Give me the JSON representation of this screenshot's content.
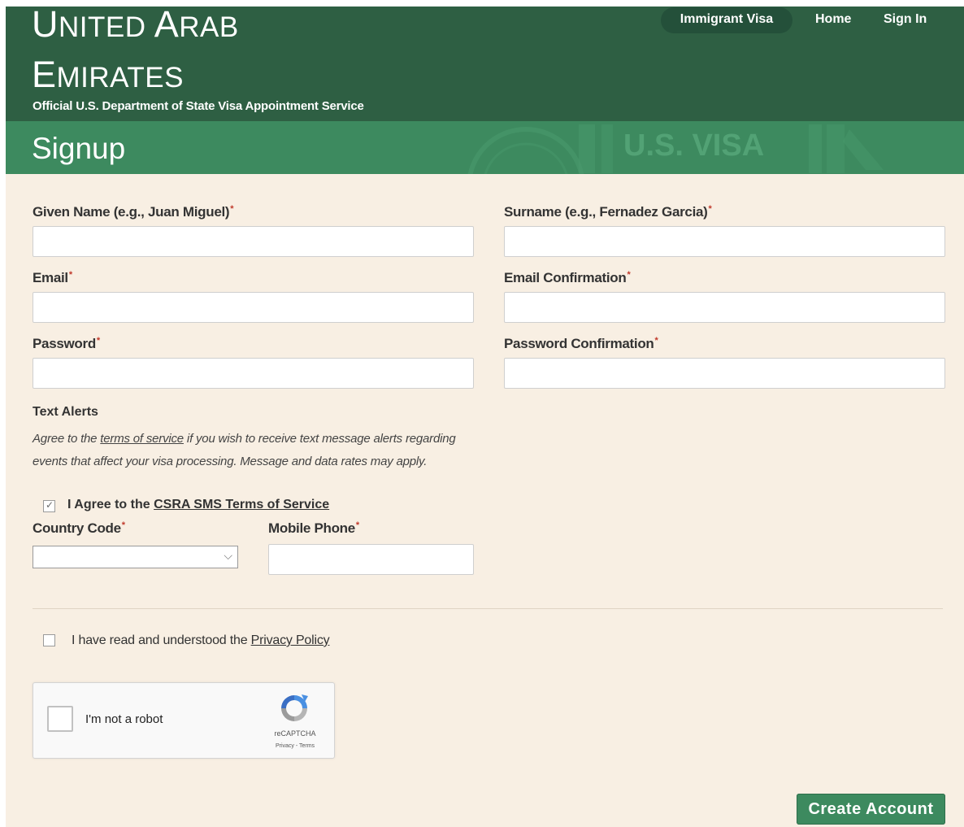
{
  "header": {
    "country_line_1_cap": "U",
    "country_line_1_rest": "nited ",
    "country_line_1_cap2": "A",
    "country_line_1_rest2": "rab",
    "country_line_2_cap": "E",
    "country_line_2_rest": "mirates",
    "subtitle": "Official U.S. Department of State Visa Appointment Service",
    "nav": {
      "immigrant_visa": "Immigrant Visa",
      "home": "Home",
      "sign_in": "Sign In"
    }
  },
  "title_band": {
    "title": "Signup",
    "watermark": "U.S. VISA"
  },
  "form": {
    "given_name": {
      "label": "Given Name (e.g., Juan Miguel)",
      "required_mark": "*",
      "value": ""
    },
    "surname": {
      "label": "Surname (e.g., Fernadez Garcia)",
      "required_mark": "*",
      "value": ""
    },
    "email": {
      "label": "Email",
      "required_mark": "*",
      "value": ""
    },
    "email_confirmation": {
      "label": "Email Confirmation",
      "required_mark": "*",
      "value": ""
    },
    "password": {
      "label": "Password",
      "required_mark": "*",
      "value": ""
    },
    "password_confirmation": {
      "label": "Password Confirmation",
      "required_mark": "*",
      "value": ""
    },
    "text_alerts": {
      "heading": "Text Alerts",
      "desc_before": "Agree to the ",
      "terms_link": "terms of service",
      "desc_after": " if you wish to receive text message alerts regarding events that affect your visa processing. Message and data rates may apply.",
      "sms_check_mark": "✓",
      "sms_label": "I Agree to the ",
      "sms_link": "CSRA SMS Terms of Service"
    },
    "country_code": {
      "label": "Country Code",
      "required_mark": "*",
      "selected": ""
    },
    "mobile_phone": {
      "label": "Mobile Phone",
      "required_mark": "*",
      "value": ""
    },
    "privacy": {
      "label": "I have read and understood the ",
      "link": "Privacy Policy"
    },
    "recaptcha": {
      "label": "I'm not a robot",
      "brand": "reCAPTCHA",
      "links": "Privacy - Terms"
    },
    "submit_label": "Create Account"
  }
}
